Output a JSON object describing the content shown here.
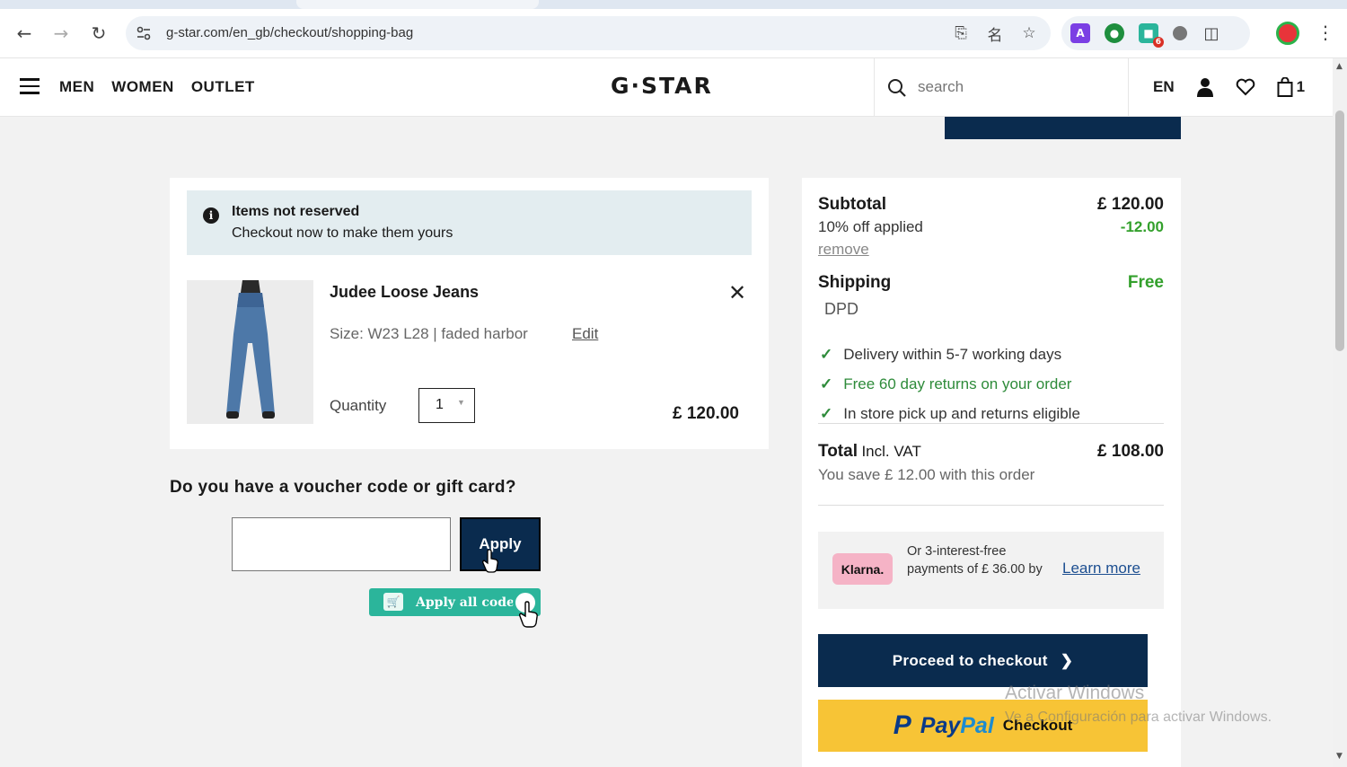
{
  "browser": {
    "url": "g-star.com/en_gb/checkout/shopping-bag",
    "extension_badge": "6",
    "ext_letter": "A"
  },
  "header": {
    "nav": [
      "MEN",
      "WOMEN",
      "OUTLET"
    ],
    "logo": "G·STAR",
    "search_placeholder": "search",
    "language": "EN",
    "bag_count": "1"
  },
  "notice": {
    "title": "Items not reserved",
    "subtitle": "Checkout now to make them yours"
  },
  "item": {
    "name": "Judee Loose Jeans",
    "meta": "Size: W23 L28 | faded harbor",
    "edit_label": "Edit",
    "quantity_label": "Quantity",
    "quantity_value": "1",
    "price": "£ 120.00"
  },
  "voucher": {
    "title": "Do you have a voucher code or gift card?",
    "input_value": "",
    "apply_label": "Apply",
    "apply_all_label": "Apply all codes"
  },
  "summary": {
    "subtotal_label": "Subtotal",
    "subtotal_value": "£ 120.00",
    "discount_label": "10% off applied",
    "discount_value": "-12.00",
    "remove_label": "remove",
    "shipping_label": "Shipping",
    "shipping_value": "Free",
    "carrier": "DPD",
    "benefits": [
      "Delivery within 5-7 working days",
      "Free 60 day returns on your order",
      "In store pick up and returns eligible"
    ],
    "total_label": "Total",
    "total_suffix": "Incl. VAT",
    "total_value": "£ 108.00",
    "savings_text": "You save £ 12.00 with this order",
    "klarna_logo": "Klarna.",
    "klarna_text": "Or 3-interest-free payments of £ 36.00 by",
    "learn_more": "Learn more",
    "checkout_label": "Proceed to checkout",
    "paypal_p": "P",
    "paypal_pay": "Pay",
    "paypal_pal": "Pal",
    "paypal_checkout": "Checkout"
  },
  "watermark": {
    "line1": "Activar Windows",
    "line2": "Ve a Configuración para activar Windows."
  },
  "colors": {
    "navy": "#0a2b4e",
    "green": "#33a02c",
    "notice_bg": "#e3edf0",
    "paypal_yellow": "#f7c436",
    "klarna_pink": "#f5b3c6",
    "honey_green": "#2bb59b"
  }
}
